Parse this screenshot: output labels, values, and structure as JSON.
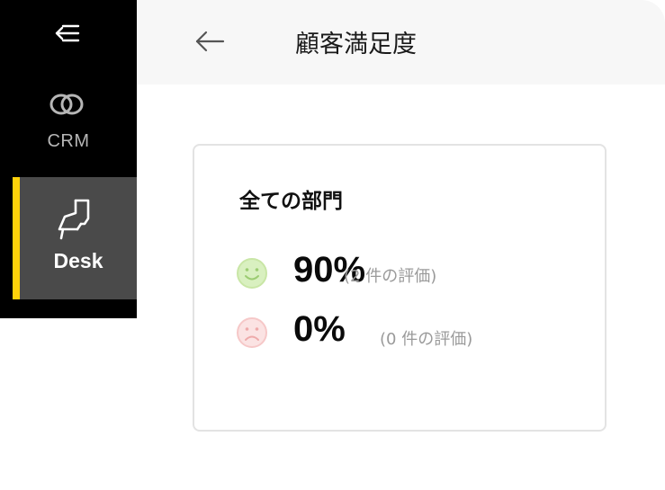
{
  "sidebar": {
    "menu_icon": "menu-collapse-icon",
    "items": [
      {
        "label": "CRM",
        "icon": "crm-rings-icon",
        "active": false
      },
      {
        "label": "Desk",
        "icon": "desk-chair-icon",
        "active": true
      }
    ]
  },
  "header": {
    "back_icon": "arrow-left-icon",
    "title": "顧客満足度"
  },
  "card": {
    "title": "全ての部門",
    "ratings": [
      {
        "icon": "smile-face-icon",
        "percent": "90%",
        "count": "(2 件の評価)",
        "color": "#c9e6a6"
      },
      {
        "icon": "sad-face-icon",
        "percent": "0%",
        "count": "(0 件の評価)",
        "color": "#f6c8c8"
      }
    ]
  },
  "colors": {
    "sidebar_bg": "#000000",
    "active_item_bg": "#4a4a4a",
    "accent": "#ffd20a",
    "header_bg": "#f7f7f7"
  }
}
